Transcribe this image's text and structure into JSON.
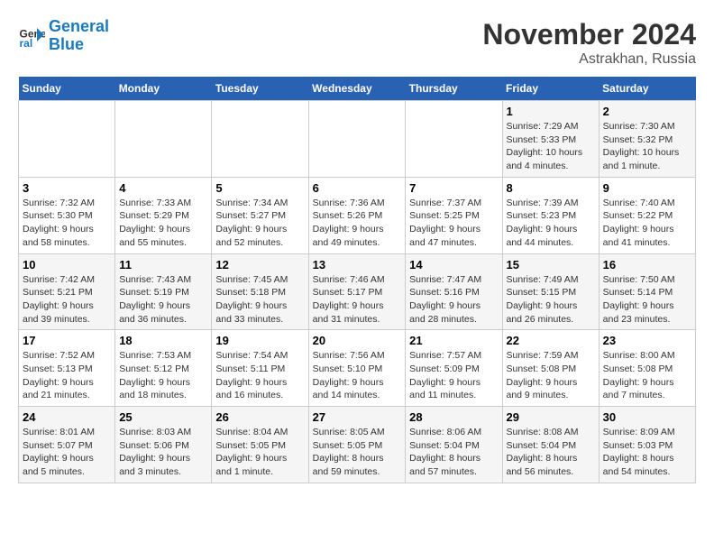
{
  "logo": {
    "line1": "General",
    "line2": "Blue"
  },
  "title": "November 2024",
  "location": "Astrakhan, Russia",
  "days_of_week": [
    "Sunday",
    "Monday",
    "Tuesday",
    "Wednesday",
    "Thursday",
    "Friday",
    "Saturday"
  ],
  "weeks": [
    {
      "days": [
        {
          "num": "",
          "sunrise": "",
          "sunset": "",
          "daylight": ""
        },
        {
          "num": "",
          "sunrise": "",
          "sunset": "",
          "daylight": ""
        },
        {
          "num": "",
          "sunrise": "",
          "sunset": "",
          "daylight": ""
        },
        {
          "num": "",
          "sunrise": "",
          "sunset": "",
          "daylight": ""
        },
        {
          "num": "",
          "sunrise": "",
          "sunset": "",
          "daylight": ""
        },
        {
          "num": "1",
          "sunrise": "Sunrise: 7:29 AM",
          "sunset": "Sunset: 5:33 PM",
          "daylight": "Daylight: 10 hours and 4 minutes."
        },
        {
          "num": "2",
          "sunrise": "Sunrise: 7:30 AM",
          "sunset": "Sunset: 5:32 PM",
          "daylight": "Daylight: 10 hours and 1 minute."
        }
      ]
    },
    {
      "days": [
        {
          "num": "3",
          "sunrise": "Sunrise: 7:32 AM",
          "sunset": "Sunset: 5:30 PM",
          "daylight": "Daylight: 9 hours and 58 minutes."
        },
        {
          "num": "4",
          "sunrise": "Sunrise: 7:33 AM",
          "sunset": "Sunset: 5:29 PM",
          "daylight": "Daylight: 9 hours and 55 minutes."
        },
        {
          "num": "5",
          "sunrise": "Sunrise: 7:34 AM",
          "sunset": "Sunset: 5:27 PM",
          "daylight": "Daylight: 9 hours and 52 minutes."
        },
        {
          "num": "6",
          "sunrise": "Sunrise: 7:36 AM",
          "sunset": "Sunset: 5:26 PM",
          "daylight": "Daylight: 9 hours and 49 minutes."
        },
        {
          "num": "7",
          "sunrise": "Sunrise: 7:37 AM",
          "sunset": "Sunset: 5:25 PM",
          "daylight": "Daylight: 9 hours and 47 minutes."
        },
        {
          "num": "8",
          "sunrise": "Sunrise: 7:39 AM",
          "sunset": "Sunset: 5:23 PM",
          "daylight": "Daylight: 9 hours and 44 minutes."
        },
        {
          "num": "9",
          "sunrise": "Sunrise: 7:40 AM",
          "sunset": "Sunset: 5:22 PM",
          "daylight": "Daylight: 9 hours and 41 minutes."
        }
      ]
    },
    {
      "days": [
        {
          "num": "10",
          "sunrise": "Sunrise: 7:42 AM",
          "sunset": "Sunset: 5:21 PM",
          "daylight": "Daylight: 9 hours and 39 minutes."
        },
        {
          "num": "11",
          "sunrise": "Sunrise: 7:43 AM",
          "sunset": "Sunset: 5:19 PM",
          "daylight": "Daylight: 9 hours and 36 minutes."
        },
        {
          "num": "12",
          "sunrise": "Sunrise: 7:45 AM",
          "sunset": "Sunset: 5:18 PM",
          "daylight": "Daylight: 9 hours and 33 minutes."
        },
        {
          "num": "13",
          "sunrise": "Sunrise: 7:46 AM",
          "sunset": "Sunset: 5:17 PM",
          "daylight": "Daylight: 9 hours and 31 minutes."
        },
        {
          "num": "14",
          "sunrise": "Sunrise: 7:47 AM",
          "sunset": "Sunset: 5:16 PM",
          "daylight": "Daylight: 9 hours and 28 minutes."
        },
        {
          "num": "15",
          "sunrise": "Sunrise: 7:49 AM",
          "sunset": "Sunset: 5:15 PM",
          "daylight": "Daylight: 9 hours and 26 minutes."
        },
        {
          "num": "16",
          "sunrise": "Sunrise: 7:50 AM",
          "sunset": "Sunset: 5:14 PM",
          "daylight": "Daylight: 9 hours and 23 minutes."
        }
      ]
    },
    {
      "days": [
        {
          "num": "17",
          "sunrise": "Sunrise: 7:52 AM",
          "sunset": "Sunset: 5:13 PM",
          "daylight": "Daylight: 9 hours and 21 minutes."
        },
        {
          "num": "18",
          "sunrise": "Sunrise: 7:53 AM",
          "sunset": "Sunset: 5:12 PM",
          "daylight": "Daylight: 9 hours and 18 minutes."
        },
        {
          "num": "19",
          "sunrise": "Sunrise: 7:54 AM",
          "sunset": "Sunset: 5:11 PM",
          "daylight": "Daylight: 9 hours and 16 minutes."
        },
        {
          "num": "20",
          "sunrise": "Sunrise: 7:56 AM",
          "sunset": "Sunset: 5:10 PM",
          "daylight": "Daylight: 9 hours and 14 minutes."
        },
        {
          "num": "21",
          "sunrise": "Sunrise: 7:57 AM",
          "sunset": "Sunset: 5:09 PM",
          "daylight": "Daylight: 9 hours and 11 minutes."
        },
        {
          "num": "22",
          "sunrise": "Sunrise: 7:59 AM",
          "sunset": "Sunset: 5:08 PM",
          "daylight": "Daylight: 9 hours and 9 minutes."
        },
        {
          "num": "23",
          "sunrise": "Sunrise: 8:00 AM",
          "sunset": "Sunset: 5:08 PM",
          "daylight": "Daylight: 9 hours and 7 minutes."
        }
      ]
    },
    {
      "days": [
        {
          "num": "24",
          "sunrise": "Sunrise: 8:01 AM",
          "sunset": "Sunset: 5:07 PM",
          "daylight": "Daylight: 9 hours and 5 minutes."
        },
        {
          "num": "25",
          "sunrise": "Sunrise: 8:03 AM",
          "sunset": "Sunset: 5:06 PM",
          "daylight": "Daylight: 9 hours and 3 minutes."
        },
        {
          "num": "26",
          "sunrise": "Sunrise: 8:04 AM",
          "sunset": "Sunset: 5:05 PM",
          "daylight": "Daylight: 9 hours and 1 minute."
        },
        {
          "num": "27",
          "sunrise": "Sunrise: 8:05 AM",
          "sunset": "Sunset: 5:05 PM",
          "daylight": "Daylight: 8 hours and 59 minutes."
        },
        {
          "num": "28",
          "sunrise": "Sunrise: 8:06 AM",
          "sunset": "Sunset: 5:04 PM",
          "daylight": "Daylight: 8 hours and 57 minutes."
        },
        {
          "num": "29",
          "sunrise": "Sunrise: 8:08 AM",
          "sunset": "Sunset: 5:04 PM",
          "daylight": "Daylight: 8 hours and 56 minutes."
        },
        {
          "num": "30",
          "sunrise": "Sunrise: 8:09 AM",
          "sunset": "Sunset: 5:03 PM",
          "daylight": "Daylight: 8 hours and 54 minutes."
        }
      ]
    }
  ]
}
